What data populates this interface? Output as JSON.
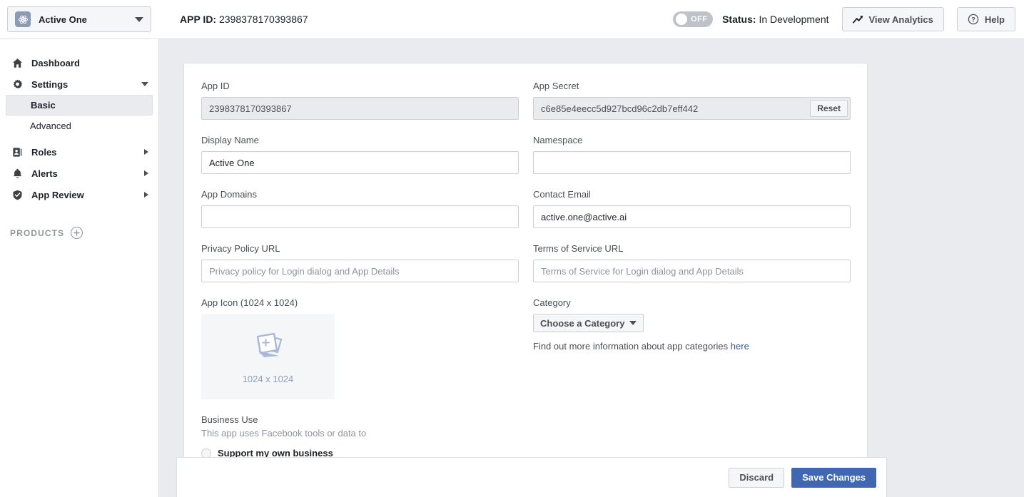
{
  "topbar": {
    "app_selector_label": "Active One",
    "app_selector_icon": "atom-icon",
    "app_id_prefix": "APP ID:",
    "app_id_value": "2398378170393867",
    "toggle_state": "OFF",
    "status_prefix": "Status:",
    "status_value": "In Development",
    "view_analytics_label": "View Analytics",
    "view_analytics_icon": "trend-up-icon",
    "help_label": "Help",
    "help_icon": "question-circle-icon"
  },
  "sidebar": {
    "items": [
      {
        "label": "Dashboard",
        "icon": "home-icon",
        "arrow": "none"
      },
      {
        "label": "Settings",
        "icon": "gear-icon",
        "arrow": "down"
      },
      {
        "label": "Roles",
        "icon": "badge-icon",
        "arrow": "right"
      },
      {
        "label": "Alerts",
        "icon": "bell-icon",
        "arrow": "right"
      },
      {
        "label": "App Review",
        "icon": "shield-check-icon",
        "arrow": "right"
      }
    ],
    "subitems": [
      {
        "label": "Basic",
        "active": true
      },
      {
        "label": "Advanced",
        "active": false
      }
    ],
    "products_label": "PRODUCTS",
    "products_add_icon": "plus-circle-icon"
  },
  "form": {
    "app_id": {
      "label": "App ID",
      "value": "2398378170393867"
    },
    "app_secret": {
      "label": "App Secret",
      "value": "c6e85e4eecc5d927bcd96c2db7eff442",
      "reset_label": "Reset"
    },
    "display_name": {
      "label": "Display Name",
      "value": "Active One",
      "placeholder": ""
    },
    "namespace": {
      "label": "Namespace",
      "value": "",
      "placeholder": ""
    },
    "app_domains": {
      "label": "App Domains",
      "value": "",
      "placeholder": ""
    },
    "contact_email": {
      "label": "Contact Email",
      "value": "active.one@active.ai",
      "placeholder": ""
    },
    "privacy_policy_url": {
      "label": "Privacy Policy URL",
      "value": "",
      "placeholder": "Privacy policy for Login dialog and App Details"
    },
    "terms_of_service_url": {
      "label": "Terms of Service URL",
      "value": "",
      "placeholder": "Terms of Service for Login dialog and App Details"
    },
    "app_icon": {
      "label": "App Icon (1024 x 1024)",
      "drop_text": "1024 x 1024",
      "icon": "photo-stack-add-icon"
    },
    "category": {
      "label": "Category",
      "button_label": "Choose a Category",
      "help_text": "Find out more information about app categories",
      "help_link": "here"
    },
    "business_use": {
      "label": "Business Use",
      "description": "This app uses Facebook tools or data to",
      "option_label": "Support my own business"
    }
  },
  "savebar": {
    "discard_label": "Discard",
    "save_label": "Save Changes"
  },
  "colors": {
    "accent": "#4267b2",
    "link": "#385898",
    "page_bg": "#e9ebee",
    "border": "#dddfe2"
  }
}
